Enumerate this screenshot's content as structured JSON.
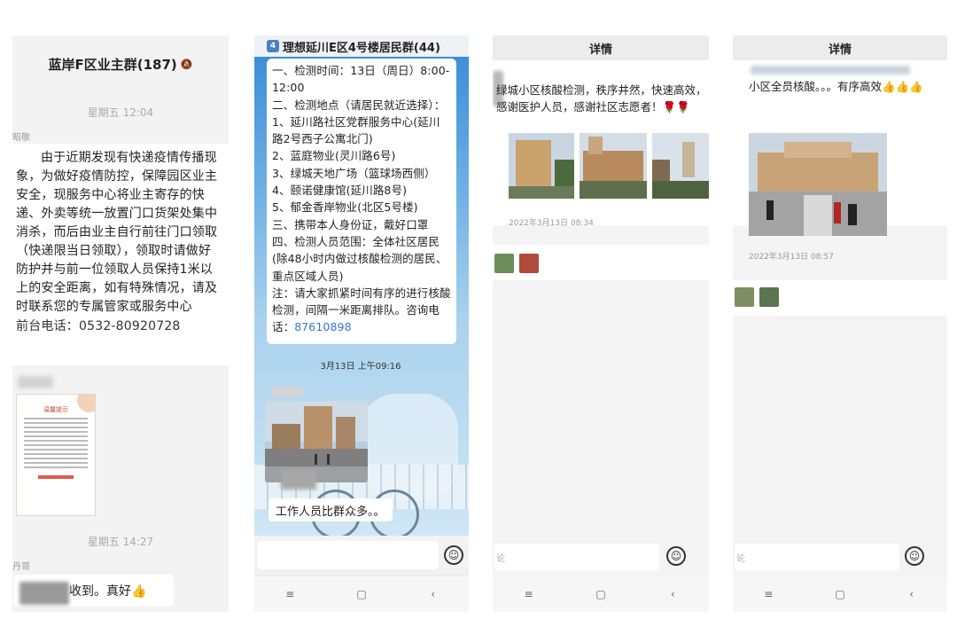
{
  "panel1": {
    "title": "蓝岸F区业主群(187)",
    "time1": "星期五 12:04",
    "sender1": "昭敬",
    "message_lines": [
      "由于近期发现有快递疫情传播现象，为做好疫情防控，保障园区业主安全，现服务中心将业主寄存的快递、外卖等统一放置门口货架处集中消杀，而后由业主自行前往门口领取（快递限当日领取），领取时请做好防护并与前一位领取人员保持1米以上的安全距离，如有特殊情况，请及时联系您的专属管家或服务中心"
    ],
    "phone": "前台电话：0532-80920728",
    "time2": "星期五 14:27",
    "sender2": "丹哥",
    "reply": "收到。真好👍"
  },
  "panel2": {
    "badge": "4",
    "title": "理想延川E区4号楼居民群(44)",
    "lines": [
      "一、检测时间：13日（周日）8:00-12:00",
      "二、检测地点（请居民就近选择）：",
      "1、延川路社区党群服务中心(延川路2号西子公寓北门)",
      "2、蓝庭物业(灵川路6号)",
      "3、绿城天地广场（篮球场西侧）",
      "4、颐诺健康馆(延川路8号)",
      "5、郁金香岸物业(北区5号楼)",
      "三、携带本人身份证，戴好口罩",
      "四、检测人员范围：全体社区居民(除48小时内做过核酸检测的居民、重点区域人员)",
      "注：请大家抓紧时间有序的进行核酸检测，间隔一米距离排队。咨询电话："
    ],
    "phone_link": "87610898",
    "timestamp": "3月13日 上午09:16",
    "message2": "工作人员比群众多。。",
    "nav": [
      "≡",
      "▢",
      "‹"
    ]
  },
  "panel3": {
    "header": "详情",
    "text": "绿城小区核酸检测，秩序井然，快速高效，感谢医护人员，感谢社区志愿者！🌹🌹",
    "stamp": "2022年3月13日 08:34",
    "input_placeholder": "论",
    "nav": [
      "≡",
      "▢",
      "‹"
    ]
  },
  "panel4": {
    "header": "详情",
    "text": "小区全员核酸。。。有序高效👍👍👍",
    "stamp": "2022年3月13日 08:57",
    "input_placeholder": "论",
    "nav": [
      "≡",
      "▢",
      "‹"
    ]
  },
  "icons": {
    "emoji": "smile-icon",
    "bell": "mute-bell-icon"
  }
}
